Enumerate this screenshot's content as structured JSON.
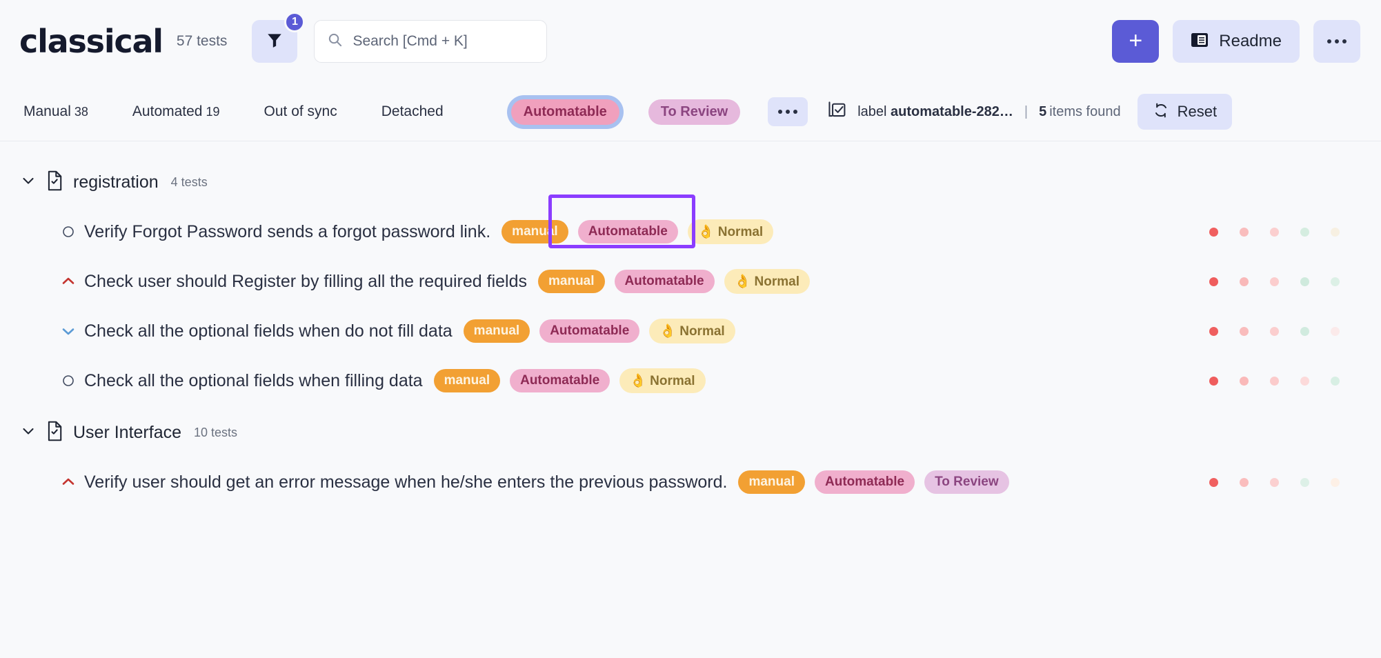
{
  "header": {
    "brand": "classical",
    "tests_count": "57 tests",
    "filter_icon": "funnel-icon",
    "filter_badge": "1",
    "search": {
      "placeholder": "Search [Cmd + K]",
      "value": "",
      "icon": "search-icon"
    },
    "add_label": "+",
    "readme_label": "Readme",
    "readme_icon": "book-icon",
    "more_label": "…"
  },
  "tabs": [
    {
      "label": "Manual",
      "count": "38",
      "type": "text",
      "active": false
    },
    {
      "label": "Automated",
      "count": "19",
      "type": "text",
      "active": false
    },
    {
      "label": "Out of sync",
      "count": "",
      "type": "text",
      "active": false
    },
    {
      "label": "Detached",
      "count": "",
      "type": "text",
      "active": false
    },
    {
      "label": "Automatable",
      "count": "",
      "type": "chip-automatable",
      "active": true
    },
    {
      "label": "To Review",
      "count": "",
      "type": "chip-toreview",
      "active": false
    }
  ],
  "toolbar": {
    "more_label": "…",
    "label_icon": "checklist-icon",
    "label_prefix": "label",
    "label_value": "automatable-282…",
    "divider": "|",
    "items_count": "5",
    "items_found_label": "items found",
    "reset_label": "Reset",
    "reset_icon": "refresh-icon"
  },
  "colors": {
    "accent": "#5b5bd6",
    "highlight": "#8b3dff",
    "chip_bg": "#dfe3fa",
    "tag_manual": "#f2a033",
    "tag_automatable": "#f0afcd",
    "tag_normal": "#fcebb9",
    "tag_toreview": "#e6c3e3"
  },
  "groups": [
    {
      "name": "registration",
      "count": "4 tests",
      "icon": "file-check-icon",
      "expanded": true,
      "tests": [
        {
          "priority_icon": "circle-icon",
          "priority_color": "#414b60",
          "title": "Verify Forgot Password sends a forgot password link.",
          "tags": [
            {
              "label": "manual",
              "style": "tag-manual"
            },
            {
              "label": "Automatable",
              "style": "tag-automatable"
            },
            {
              "label": "👌 Normal",
              "style": "tag-normal"
            }
          ],
          "status_dots": [
            "#f05f5f",
            "#f9bdbd",
            "#fbcfcf",
            "#d5ede0",
            "#f7f0e2"
          ]
        },
        {
          "priority_icon": "chevron-up-icon",
          "priority_color": "#c4342f",
          "title": "Check user should Register by filling all the required fields",
          "tags": [
            {
              "label": "manual",
              "style": "tag-manual"
            },
            {
              "label": "Automatable",
              "style": "tag-automatable"
            },
            {
              "label": "👌 Normal",
              "style": "tag-normal"
            }
          ],
          "status_dots": [
            "#ef5d5d",
            "#f9b9b9",
            "#fbcdcd",
            "#cfeadd",
            "#dcf0e6"
          ]
        },
        {
          "priority_icon": "chevron-down-icon",
          "priority_color": "#5b9bd5",
          "title": "Check all the optional fields when do not fill data",
          "tags": [
            {
              "label": "manual",
              "style": "tag-manual"
            },
            {
              "label": "Automatable",
              "style": "tag-automatable"
            },
            {
              "label": "👌 Normal",
              "style": "tag-normal"
            }
          ],
          "status_dots": [
            "#ef5f5f",
            "#f9bcbc",
            "#fbcece",
            "#d1ebdf",
            "#fbeaea"
          ]
        },
        {
          "priority_icon": "circle-icon",
          "priority_color": "#414b60",
          "title": "Check all the optional fields when filling data",
          "tags": [
            {
              "label": "manual",
              "style": "tag-manual"
            },
            {
              "label": "Automatable",
              "style": "tag-automatable"
            },
            {
              "label": "👌 Normal",
              "style": "tag-normal"
            }
          ],
          "status_dots": [
            "#ef5d5d",
            "#fab9b9",
            "#fbcbcb",
            "#fcdada",
            "#d8efe4"
          ]
        }
      ]
    },
    {
      "name": "User Interface",
      "count": "10 tests",
      "icon": "file-check-icon",
      "expanded": true,
      "tests": [
        {
          "priority_icon": "chevron-up-icon",
          "priority_color": "#c4342f",
          "title": "Verify user should get an error message when he/she enters the previous password.",
          "tags": [
            {
              "label": "manual",
              "style": "tag-manual"
            },
            {
              "label": "Automatable",
              "style": "tag-automatable"
            },
            {
              "label": "To Review",
              "style": "tag-toreview"
            }
          ],
          "status_dots": [
            "#f06060",
            "#fabdbd",
            "#fbd0d0",
            "#ddf0e7",
            "#fdf0e6"
          ]
        }
      ]
    }
  ]
}
